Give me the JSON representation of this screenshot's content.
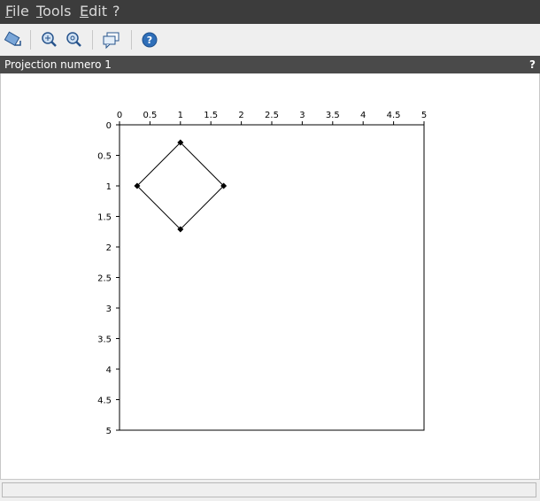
{
  "menu": {
    "file": "File",
    "tools": "Tools",
    "edit": "Edit",
    "help": "?"
  },
  "toolbar": {
    "buttons": [
      {
        "icon": "rotate-icon"
      },
      {
        "icon": "zoom-in-icon"
      },
      {
        "icon": "zoom-reset-icon"
      },
      {
        "icon": "datatip-icon"
      },
      {
        "icon": "help-icon"
      }
    ]
  },
  "figure": {
    "title": "Projection numero 1",
    "help_label": "?"
  },
  "status": {
    "text": ""
  },
  "chart_data": {
    "type": "line",
    "x_axis_position": "top",
    "y_axis_reversed": true,
    "xlim": [
      0,
      5
    ],
    "ylim": [
      0,
      5
    ],
    "xticks": [
      "0",
      "0.5",
      "1",
      "1.5",
      "2",
      "2.5",
      "3",
      "3.5",
      "4",
      "4.5",
      "5"
    ],
    "yticks": [
      "0",
      "0.5",
      "1",
      "1.5",
      "2",
      "2.5",
      "3",
      "3.5",
      "4",
      "4.5",
      "5"
    ],
    "grid": false,
    "series": [
      {
        "points": [
          [
            1,
            0.29
          ],
          [
            1.71,
            1
          ],
          [
            1,
            1.71
          ],
          [
            0.29,
            1
          ],
          [
            1,
            0.29
          ]
        ],
        "marker": "diamond",
        "color": "#000000"
      }
    ]
  }
}
